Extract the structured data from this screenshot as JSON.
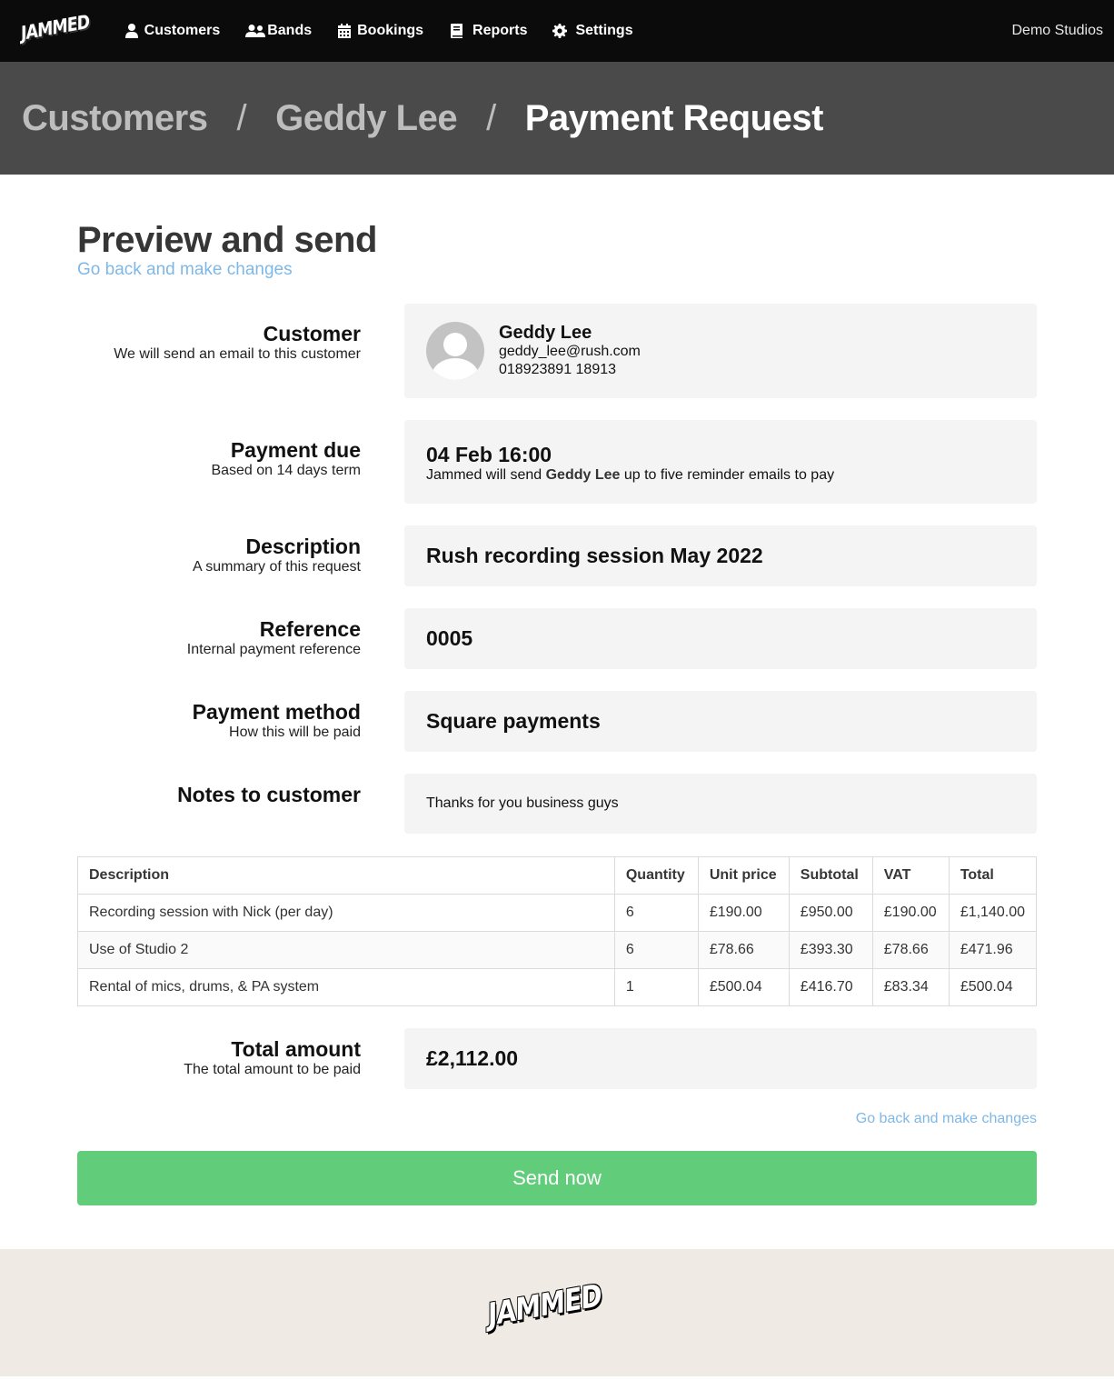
{
  "nav": {
    "logo": "JAMMED",
    "items": [
      {
        "label": "Customers",
        "icon": "user-icon"
      },
      {
        "label": "Bands",
        "icon": "users-icon"
      },
      {
        "label": "Bookings",
        "icon": "calendar-icon"
      },
      {
        "label": "Reports",
        "icon": "book-icon"
      },
      {
        "label": "Settings",
        "icon": "gear-icon"
      }
    ],
    "studio": "Demo Studios"
  },
  "breadcrumb": {
    "items": [
      "Customers",
      "Geddy Lee",
      "Payment Request"
    ],
    "separator": "/"
  },
  "page": {
    "title": "Preview and send",
    "back_link": "Go back and make changes"
  },
  "sections": {
    "customer": {
      "label": "Customer",
      "sub": "We will send an email to this customer",
      "name": "Geddy Lee",
      "email": "geddy_lee@rush.com",
      "phone": "018923891 18913"
    },
    "payment_due": {
      "label": "Payment due",
      "sub": "Based on 14 days term",
      "date": "04 Feb 16:00",
      "note_prefix": "Jammed will send ",
      "note_name": "Geddy Lee",
      "note_suffix": " up to five reminder emails to pay"
    },
    "description": {
      "label": "Description",
      "sub": "A summary of this request",
      "value": "Rush recording session May 2022"
    },
    "reference": {
      "label": "Reference",
      "sub": "Internal payment reference",
      "value": "0005"
    },
    "payment_method": {
      "label": "Payment method",
      "sub": "How this will be paid",
      "value": "Square payments"
    },
    "notes": {
      "label": "Notes to customer",
      "value": "Thanks for you business guys"
    }
  },
  "table": {
    "headers": [
      "Description",
      "Quantity",
      "Unit price",
      "Subtotal",
      "VAT",
      "Total"
    ],
    "rows": [
      [
        "Recording session with Nick (per day)",
        "6",
        "£190.00",
        "£950.00",
        "£190.00",
        "£1,140.00"
      ],
      [
        "Use of Studio 2",
        "6",
        "£78.66",
        "£393.30",
        "£78.66",
        "£471.96"
      ],
      [
        "Rental of mics, drums, & PA system",
        "1",
        "£500.04",
        "£416.70",
        "£83.34",
        "£500.04"
      ]
    ]
  },
  "total": {
    "label": "Total amount",
    "sub": "The total amount to be paid",
    "value": "£2,112.00"
  },
  "footer_actions": {
    "back_link": "Go back and make changes",
    "send_label": "Send now"
  },
  "footer": {
    "logo": "JAMMED"
  },
  "colors": {
    "link": "#7fb8e6",
    "send_button": "#61cd7b",
    "nav_bg": "#0b0b0b",
    "breadcrumb_bg": "#4a4a4a",
    "footer_bg": "#efebe4"
  }
}
